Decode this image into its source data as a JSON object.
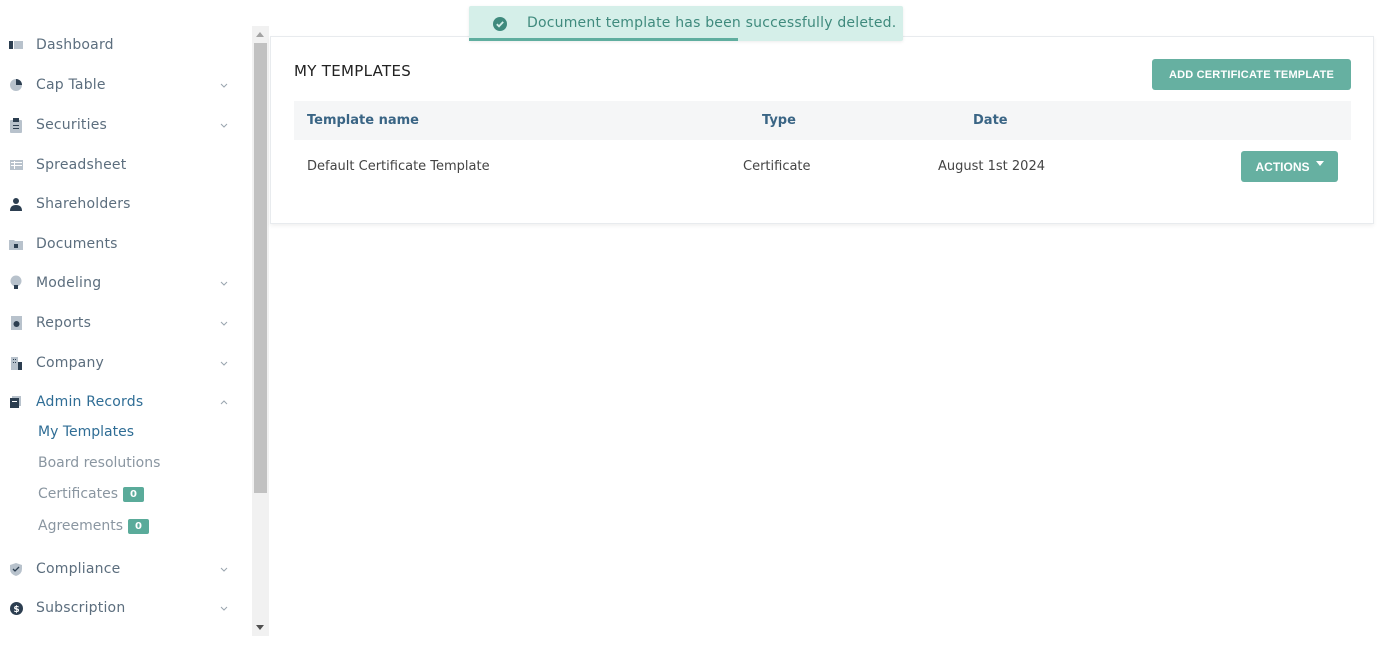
{
  "sidebar": {
    "items": [
      {
        "label": "Dashboard",
        "icon": "dashboard-icon",
        "expandable": false
      },
      {
        "label": "Cap Table",
        "icon": "pie-chart-icon",
        "expandable": true
      },
      {
        "label": "Securities",
        "icon": "clipboard-icon",
        "expandable": true
      },
      {
        "label": "Spreadsheet",
        "icon": "table-icon",
        "expandable": false
      },
      {
        "label": "Shareholders",
        "icon": "user-icon",
        "expandable": false
      },
      {
        "label": "Documents",
        "icon": "folder-icon",
        "expandable": false
      },
      {
        "label": "Modeling",
        "icon": "lightbulb-icon",
        "expandable": true
      },
      {
        "label": "Reports",
        "icon": "report-icon",
        "expandable": true
      },
      {
        "label": "Company",
        "icon": "building-icon",
        "expandable": true
      },
      {
        "label": "Admin Records",
        "icon": "records-icon",
        "expandable": true,
        "expanded": true
      },
      {
        "label": "Compliance",
        "icon": "shield-icon",
        "expandable": true
      },
      {
        "label": "Subscription",
        "icon": "dollar-icon",
        "expandable": true
      }
    ],
    "sub_items": [
      {
        "label": "My Templates",
        "active": true
      },
      {
        "label": "Board resolutions"
      },
      {
        "label": "Certificates",
        "badge": "0"
      },
      {
        "label": "Agreements",
        "badge": "0"
      }
    ]
  },
  "toast": {
    "message": "Document template has been successfully deleted.",
    "icon": "check-circle-icon",
    "progress": 0.62
  },
  "main": {
    "title": "MY TEMPLATES",
    "add_button": "ADD CERTIFICATE TEMPLATE",
    "table": {
      "headers": [
        "Template name",
        "Type",
        "Date"
      ],
      "rows": [
        {
          "name": "Default Certificate Template",
          "type": "Certificate",
          "date": "August 1st 2024",
          "actions": "ACTIONS"
        }
      ]
    }
  },
  "colors": {
    "accent": "#66b0a1",
    "active_link": "#2f6d95",
    "toast_bg": "#d5efe9"
  }
}
